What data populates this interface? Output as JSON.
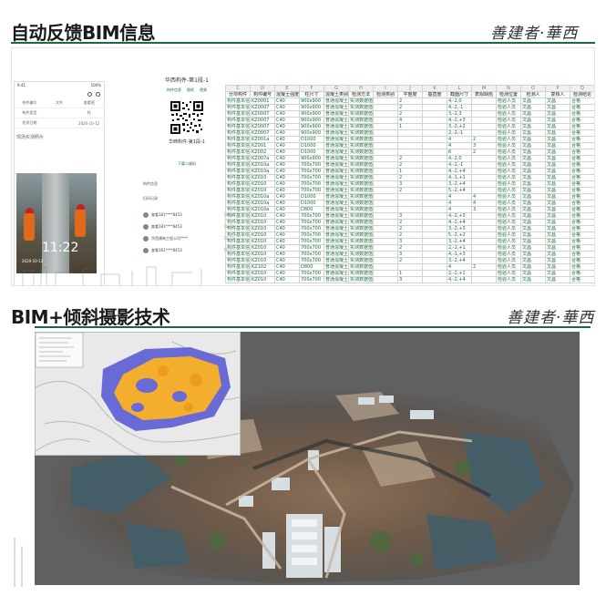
{
  "sections": [
    {
      "title": "自动反馈BIM信息",
      "sign": "善建者·華西"
    },
    {
      "title": "BIM+倾斜摄影技术",
      "sign": "善建者·華西"
    }
  ],
  "colors": {
    "accent": "#1b6b3a",
    "sheet_text": "#1b6b3a",
    "map_bg": "#5f6062"
  },
  "phone": {
    "status_left": "9:41",
    "status_right": "100%",
    "info_rows": [
      [
        "构件编号",
        "文件",
        "查看图"
      ],
      [
        "构件类型",
        "",
        "柱"
      ],
      [
        "检测日期",
        "",
        "2020-10-12"
      ]
    ],
    "photo_label": "现场实测照片",
    "photo_time": "11:22",
    "photo_caption": "2020-10-12"
  },
  "qr_pane": {
    "title": "华西构件-第1段-1",
    "links": [
      "构件信息",
      "图纸",
      "视频"
    ],
    "caption": "华西构件-第1段-1",
    "button": "下载二维码",
    "section_label": "构件信息",
    "records_label": "扫码记录",
    "records": [
      {
        "name": "查看181****8453",
        "time": "10-12"
      },
      {
        "name": "查看181****8453",
        "time": "10-12"
      },
      {
        "name": "华西建筑工程公司****",
        "time": "10-12"
      },
      {
        "name": "查看181****8453",
        "time": "10-12"
      }
    ]
  },
  "sheet": {
    "letters": [
      "C",
      "D",
      "E",
      "F",
      "G",
      "H",
      "I",
      "J",
      "K",
      "L",
      "M",
      "N",
      "O",
      "P",
      "Q"
    ],
    "headers": [
      "分项构件",
      "构件编号",
      "混凝土强度",
      "柱尺寸",
      "混凝土类别",
      "检测方法",
      "检测类别",
      "平整度",
      "垂直度",
      "截面尺寸",
      "表观缺陷",
      "检测位置",
      "检测人",
      "复核人",
      "检测结论"
    ],
    "rows": [
      [
        "构件基本信",
        "KZ0001",
        "C40",
        "900x900",
        "普通混凝土",
        "实测数据值",
        "",
        "2",
        "",
        "4,-2,0",
        "",
        "检验人员",
        "文昌",
        "文昌",
        "合格"
      ],
      [
        "构件基本信",
        "KZ0007",
        "C40",
        "900x900",
        "普通混凝土",
        "实测数据值",
        "",
        "2",
        "",
        "4,-2,-1",
        "",
        "检验人员",
        "文昌",
        "文昌",
        "合格"
      ],
      [
        "构件基本信",
        "KZ0007",
        "C40",
        "900x900",
        "普通混凝土",
        "实测数据值",
        "",
        "2",
        "",
        "3,-2,3",
        "",
        "检验人员",
        "文昌",
        "文昌",
        "合格"
      ],
      [
        "构件基本信",
        "KZ0007",
        "C40",
        "900x900",
        "普通混凝土",
        "实测数据值",
        "",
        "4",
        "",
        "4,-2,+3",
        "",
        "检验人员",
        "文昌",
        "文昌",
        "合格"
      ],
      [
        "构件基本信",
        "KZ0007",
        "C40",
        "900x900",
        "普通混凝土",
        "实测数据值",
        "",
        "1",
        "",
        "3,-2,+2",
        "",
        "检验人员",
        "文昌",
        "文昌",
        "合格"
      ],
      [
        "构件基本信",
        "KZ0007",
        "C40",
        "900x900",
        "普通混凝土",
        "实测数据值",
        "",
        "",
        "",
        "2,-2,-1",
        "",
        "检验人员",
        "文昌",
        "文昌",
        "合格"
      ],
      [
        "构件基本信",
        "KZ001a",
        "C40",
        "D1000",
        "普通混凝土",
        "实测数据值/",
        "",
        "",
        "",
        "4",
        "2",
        "检验人员",
        "文昌",
        "文昌",
        "合格"
      ],
      [
        "构件基本信",
        "KZ001",
        "C40",
        "D1000",
        "普通混凝土",
        "实测数据值/",
        "",
        "",
        "",
        "4",
        "3",
        "检验人员",
        "文昌",
        "文昌",
        "合格"
      ],
      [
        "构件基本信",
        "KZ002",
        "C40",
        "D1000",
        "普通混凝土",
        "实测数据值/",
        "",
        "",
        "",
        "6",
        "2",
        "检验人员",
        "文昌",
        "文昌",
        "合格"
      ],
      [
        "构件基本信",
        "KZ007a",
        "C40",
        "900x900",
        "普通混凝土",
        "实测数据值",
        "",
        "2",
        "",
        "4,-2,0",
        "",
        "检验人员",
        "文昌",
        "文昌",
        "合格"
      ],
      [
        "构件基本信",
        "KZ010a",
        "C40",
        "700x700",
        "普通混凝土",
        "实测数据值",
        "",
        "2",
        "",
        "4,-2,-1",
        "",
        "检验人员",
        "文昌",
        "文昌",
        "合格"
      ],
      [
        "构件基本信",
        "KZ010a",
        "C40",
        "700x700",
        "普通混凝土",
        "实测数据值",
        "",
        "1",
        "",
        "4,-2,+4",
        "",
        "检验人员",
        "文昌",
        "文昌",
        "合格"
      ],
      [
        "构件基本信",
        "KZ010",
        "C40",
        "700x700",
        "普通混凝土",
        "实测数据值",
        "",
        "2",
        "",
        "4,-1,+1",
        "",
        "检验人员",
        "文昌",
        "文昌",
        "合格"
      ],
      [
        "构件基本信",
        "KZ010",
        "C40",
        "700x700",
        "普通混凝土",
        "实测数据值",
        "",
        "3",
        "",
        "3,-2,+4",
        "",
        "检验人员",
        "文昌",
        "文昌",
        "合格"
      ],
      [
        "构件基本信",
        "KZ010",
        "C40",
        "700x700",
        "普通混凝土",
        "实测数据值",
        "",
        "2",
        "",
        "5,-2,+4",
        "",
        "检验人员",
        "文昌",
        "文昌",
        "合格"
      ],
      [
        "构件基本信",
        "KZ010a",
        "C40",
        "D1000",
        "普通混凝土",
        "实测数据值/",
        "",
        "",
        "",
        "4",
        "4",
        "检验人员",
        "文昌",
        "文昌",
        "合格"
      ],
      [
        "构件基本信",
        "KZ010a",
        "C40",
        "D1000",
        "普通混凝土",
        "实测数据值/",
        "",
        "",
        "",
        "4",
        "4",
        "检验人员",
        "文昌",
        "文昌",
        "合格"
      ],
      [
        "构件基本信",
        "KZ010a",
        "C40",
        "D800",
        "普通混凝土",
        "实测数据值/",
        "",
        "",
        "",
        "4",
        "3",
        "检验人员",
        "文昌",
        "文昌",
        "合格"
      ],
      [
        "构件基本信",
        "KZ010",
        "C40",
        "700x700",
        "普通混凝土",
        "实测数据值",
        "",
        "3",
        "",
        "4,-2,+3",
        "",
        "检验人员",
        "文昌",
        "文昌",
        "合格"
      ],
      [
        "构件基本信",
        "KZ010",
        "C40",
        "700x700",
        "普通混凝土",
        "实测数据值",
        "",
        "2",
        "",
        "4,-2,+4",
        "",
        "检验人员",
        "文昌",
        "文昌",
        "合格"
      ],
      [
        "构件基本信",
        "KZ010",
        "C40",
        "700x700",
        "普通混凝土",
        "实测数据值",
        "",
        "2",
        "",
        "3,-2,+3",
        "",
        "检验人员",
        "文昌",
        "文昌",
        "合格"
      ],
      [
        "构件基本信",
        "KZ010",
        "C40",
        "700x700",
        "普通混凝土",
        "实测数据值",
        "",
        "2",
        "",
        "5,-2,+2",
        "",
        "检验人员",
        "文昌",
        "文昌",
        "合格"
      ],
      [
        "构件基本信",
        "KZ010",
        "C40",
        "700x700",
        "普通混凝土",
        "实测数据值",
        "",
        "3",
        "",
        "3,-2,+4",
        "",
        "检验人员",
        "文昌",
        "文昌",
        "合格"
      ],
      [
        "构件基本信",
        "KZ010",
        "C40",
        "700x700",
        "普通混凝土",
        "实测数据值",
        "",
        "2",
        "",
        "2,-2,+1",
        "",
        "检验人员",
        "文昌",
        "文昌",
        "合格"
      ],
      [
        "构件基本信",
        "KZ010",
        "C40",
        "700x700",
        "普通混凝土",
        "实测数据值",
        "",
        "3",
        "",
        "4,-1,+3",
        "",
        "检验人员",
        "文昌",
        "文昌",
        "合格"
      ],
      [
        "构件基本信",
        "KZ010",
        "C40",
        "700x700",
        "普通混凝土",
        "实测数据值",
        "",
        "2",
        "",
        "3,-2,+4",
        "",
        "检验人员",
        "文昌",
        "文昌",
        "合格"
      ],
      [
        "构件基本信",
        "KZ102",
        "C40",
        "D800",
        "普通混凝土",
        "实测数据值/",
        "",
        "",
        "",
        "4",
        "2",
        "检验人员",
        "文昌",
        "文昌",
        "合格"
      ],
      [
        "构件基本信",
        "KZ010",
        "C40",
        "700x700",
        "普通混凝土",
        "实测数据值",
        "",
        "1",
        "",
        "2,-2,+1",
        "",
        "检验人员",
        "文昌",
        "文昌",
        "合格"
      ],
      [
        "构件基本信",
        "KZ010",
        "C40",
        "700x700",
        "普通混凝土",
        "实测数据值",
        "",
        "3",
        "",
        "4,-2,+4",
        "",
        "检验人员",
        "文昌",
        "文昌",
        "合格"
      ]
    ]
  }
}
